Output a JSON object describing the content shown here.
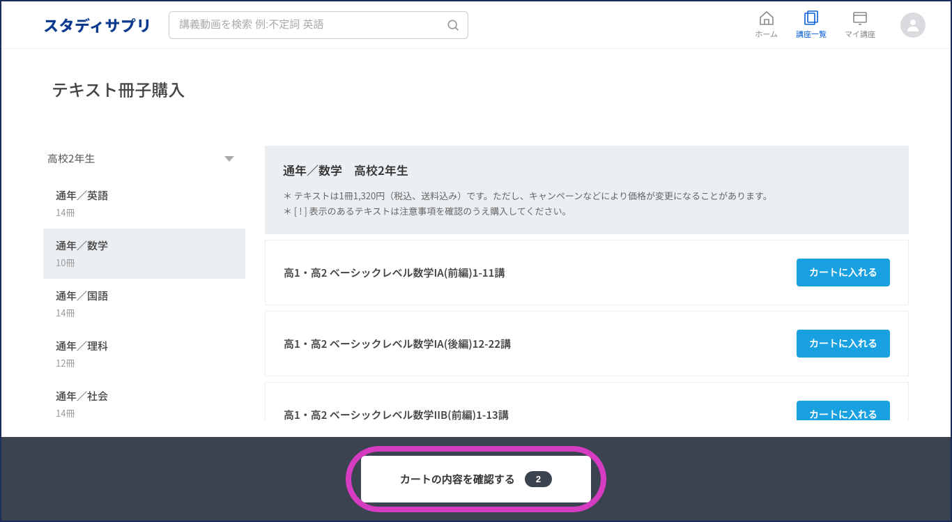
{
  "header": {
    "logo": "スタディサプリ",
    "search_placeholder": "講義動画を検索 例:不定詞 英語",
    "nav": {
      "home": "ホーム",
      "courses": "講座一覧",
      "mycourse": "マイ講座"
    }
  },
  "page": {
    "title": "テキスト冊子購入"
  },
  "sidebar": {
    "grade": "高校2年生",
    "items": [
      {
        "name": "通年／英語",
        "count": "14冊"
      },
      {
        "name": "通年／数学",
        "count": "10冊"
      },
      {
        "name": "通年／国語",
        "count": "14冊"
      },
      {
        "name": "通年／理科",
        "count": "12冊"
      },
      {
        "name": "通年／社会",
        "count": "14冊"
      }
    ]
  },
  "main": {
    "hdr_title": "通年／数学　高校2年生",
    "note1": "＊ テキストは1冊1,320円（税込、送料込み）です。ただし、キャンペーンなどにより価格が変更になることがあります。",
    "note2": "＊ [ ! ] 表示のあるテキストは注意事項を確認のうえ購入してください。",
    "add_label": "カートに入れる",
    "books": [
      {
        "title": "高1・高2 ベーシックレベル数学IA(前編)1-11講"
      },
      {
        "title": "高1・高2 ベーシックレベル数学IA(後編)12-22講"
      },
      {
        "title": "高1・高2 ベーシックレベル数学IIB(前編)1-13講"
      }
    ]
  },
  "footer": {
    "cart_label": "カートの内容を確認する",
    "cart_count": "2"
  }
}
